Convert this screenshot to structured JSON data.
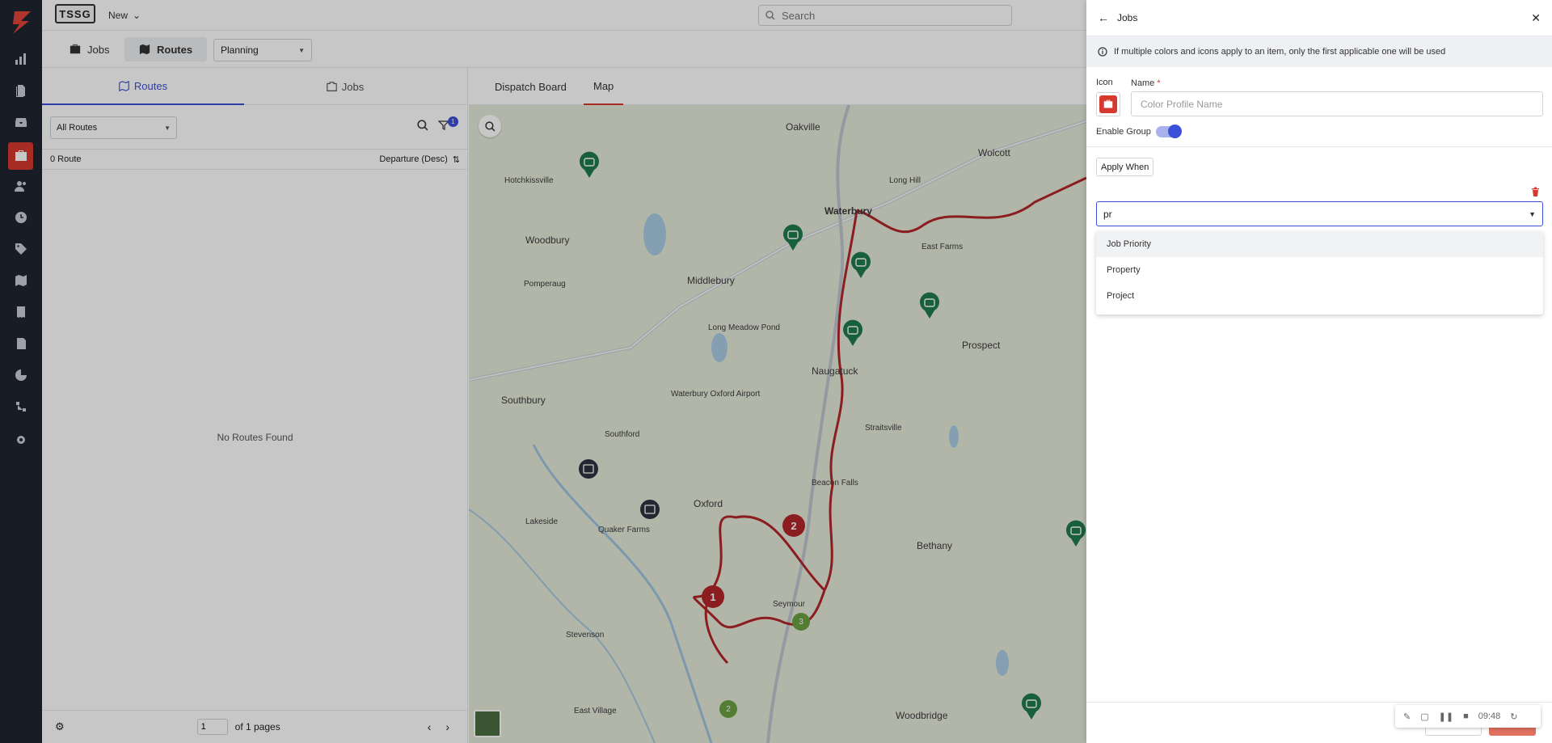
{
  "topbar": {
    "brand": "TSSG",
    "new_label": "New",
    "search_placeholder": "Search"
  },
  "subbar": {
    "tabs": [
      {
        "label": "Jobs"
      },
      {
        "label": "Routes"
      }
    ],
    "view_select": "Planning"
  },
  "left_panel": {
    "tabs": [
      {
        "label": "Routes"
      },
      {
        "label": "Jobs"
      }
    ],
    "route_filter": "All Routes",
    "filter_badge": "1",
    "count": "0 Route",
    "sort": "Departure (Desc)",
    "empty": "No Routes Found",
    "pager": {
      "page": "1",
      "of_label": "of 1 pages"
    }
  },
  "map_panel": {
    "tabs": [
      {
        "label": "Dispatch Board"
      },
      {
        "label": "Map"
      }
    ],
    "places": {
      "oakville": "Oakville",
      "hotchkissville": "Hotchkissville",
      "woodbury": "Woodbury",
      "waterbury": "Waterbury",
      "wolcott": "Wolcott",
      "middlebury": "Middlebury",
      "pomperaug": "Pomperaug",
      "naugatuck": "Naugatuck",
      "prospect": "Prospect",
      "southbury": "Southbury",
      "southford": "Southford",
      "oxford": "Oxford",
      "beacon_falls": "Beacon Falls",
      "bethany": "Bethany",
      "seymour": "Seymour",
      "stevenson": "Stevenson",
      "woodbridge": "Woodbridge",
      "east_village": "East Village",
      "quaker_farms": "Quaker Farms",
      "lakeside": "Lakeside",
      "straitsville": "Straitsville",
      "waterbury_oxford_airport": "Waterbury Oxford Airport",
      "long_meadow_pond": "Long Meadow Pond",
      "east_farms": "East Farms",
      "long_hill": "Long Hill"
    },
    "route_badges": [
      "2",
      "1"
    ],
    "cluster_badges": [
      "3",
      "2"
    ]
  },
  "drawer": {
    "title": "Jobs",
    "info": "If multiple colors and icons apply to an item, only the first applicable one will be used",
    "icon_label": "Icon",
    "name_label": "Name",
    "required_mark": "*",
    "name_placeholder": "Color Profile Name",
    "name_value": "",
    "enable_group_label": "Enable Group",
    "enable_group_on": true,
    "apply_when_label": "Apply When",
    "condition_input": "pr",
    "options": [
      {
        "label": "Job Priority"
      },
      {
        "label": "Property"
      },
      {
        "label": "Project"
      }
    ],
    "cancel_label": "Cancel",
    "save_label": "Save",
    "timer": "09:48"
  },
  "colors": {
    "accent": "#3b4fd8",
    "brand_red": "#d63a2f",
    "rail": "#1e2430",
    "map_marker_green": "#1f7a4d",
    "route_line": "#b3262a"
  }
}
